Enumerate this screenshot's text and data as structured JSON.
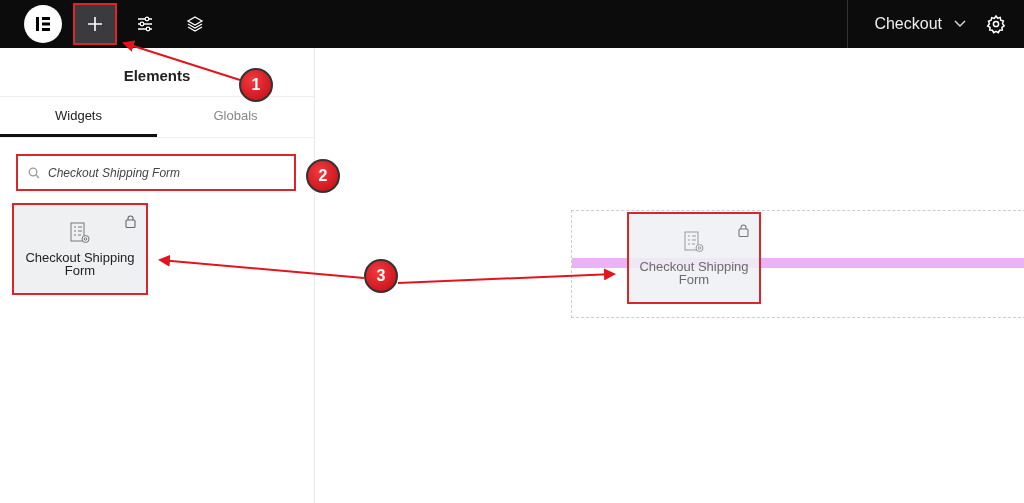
{
  "toolbar": [
    {
      "kind": "add",
      "selected": true
    },
    {
      "kind": "sliders",
      "selected": false
    },
    {
      "kind": "layers",
      "selected": false
    }
  ],
  "page_title": "Checkout",
  "panel": {
    "title": "Elements",
    "tabs": [
      {
        "label": "Widgets",
        "selected": true
      },
      {
        "label": "Globals",
        "selected": false
      }
    ],
    "search": {
      "value": "Checkout Shipping Form"
    },
    "widgets": [
      {
        "label": "Checkout Shipping Form",
        "locked": true
      }
    ]
  },
  "canvas": {
    "dragged_widget": {
      "label": "Checkout Shipping Form",
      "locked": true
    }
  },
  "steps": [
    {
      "number": "1"
    },
    {
      "number": "2"
    },
    {
      "number": "3"
    }
  ]
}
